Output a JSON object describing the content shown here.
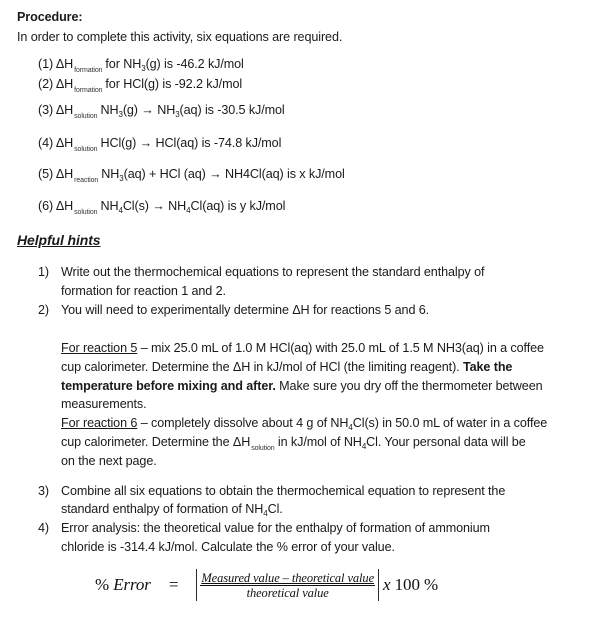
{
  "procedure": {
    "title": "Procedure:",
    "intro": "In order to complete this activity, six equations are required."
  },
  "equations": [
    {
      "num": "(1)",
      "delta": "ΔH",
      "sub": "formation",
      "pre": "for NH",
      "pre_sub": "3",
      "post": "(g) is -46.2 kJ/mol"
    },
    {
      "num": "(2)",
      "delta": "ΔH",
      "sub": "formation",
      "text": "for HCl(g) is -92.2 kJ/mol"
    },
    {
      "num": "(3)",
      "delta": "ΔH",
      "sub": "solution",
      "a": "NH",
      "a_sub": "3",
      "b": "(g) → NH",
      "b_sub": "3",
      "c": "(aq) is -30.5 kJ/mol"
    },
    {
      "num": "(4)",
      "delta": "ΔH",
      "sub": "solution",
      "text": "HCl(g) → HCl(aq) is -74.8 kJ/mol"
    },
    {
      "num": "(5)",
      "delta": "ΔH",
      "sub": "reaction",
      "a": "NH",
      "a_sub": "3",
      "b": "(aq) + HCl (aq) → NH4Cl(aq) is x kJ/mol"
    },
    {
      "num": "(6)",
      "delta": "ΔH",
      "sub": "solution",
      "a": "NH",
      "a_sub": "4",
      "b": "Cl(s) → NH",
      "b_sub": "4",
      "c": "Cl(aq) is y kJ/mol"
    }
  ],
  "hints": {
    "title": "Helpful hints",
    "items": [
      {
        "num": "1)",
        "line1": "Write out the thermochemical equations to represent the standard enthalpy of",
        "line2": "formation for reaction 1 and 2."
      },
      {
        "num": "2)",
        "line1": "You will need to experimentally determine ΔH for reactions 5 and 6."
      },
      {
        "num": "3)",
        "line1": "Combine all six equations to obtain the thermochemical equation to represent the",
        "line2_a": "standard enthalpy of formation of NH",
        "line2_sub": "4",
        "line2_b": "Cl."
      },
      {
        "num": "4)",
        "line1": "Error analysis:  the theoretical value for the enthalpy of formation of ammonium",
        "line2": "chloride is -314.4 kJ/mol.  Calculate the % error of your value."
      }
    ],
    "reaction5": {
      "label": "For reaction 5",
      "line1_rest": " – mix 25.0 mL of 1.0 M HCl(aq) with 25.0 mL of 1.5 M NH3(aq) in a coffee",
      "line2_normal": "cup calorimeter.  Determine the ΔH in kJ/mol of HCl (the limiting reagent).  ",
      "line2_bold": "Take the",
      "line3_bold": "temperature before mixing and after.",
      "line3_normal": "  Make sure you dry off the thermometer between",
      "line4": "measurements."
    },
    "reaction6": {
      "label": "For reaction 6",
      "line1_a": " – completely dissolve about 4 g of NH",
      "line1_sub": "4",
      "line1_b": "Cl(s) in 50.0 mL of water in a coffee",
      "line2_a": "cup calorimeter.  Determine the ΔH",
      "line2_sub_word": "solution",
      "line2_b": " in kJ/mol of NH",
      "line2_sub": "4",
      "line2_c": "Cl.  Your personal data will be",
      "line3": "on the next page."
    }
  },
  "formula": {
    "pct_sign": "%",
    "lhs": "Error",
    "equals": "=",
    "numerator": "Measured value – theoretical value",
    "denominator": "theoretical value",
    "times": "x",
    "hundred": "100 %"
  }
}
